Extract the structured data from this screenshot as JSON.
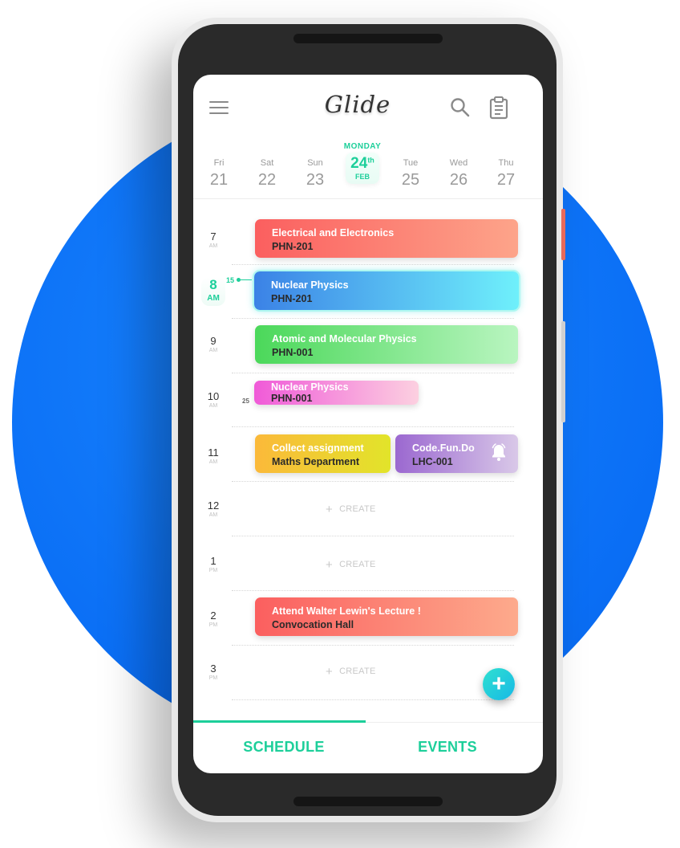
{
  "app": {
    "title": "Glide"
  },
  "colors": {
    "accent": "#1dcf9a",
    "background_circle": "#0a6ef5"
  },
  "dates": [
    {
      "day": "Fri",
      "num": "21"
    },
    {
      "day": "Sat",
      "num": "22"
    },
    {
      "day": "Sun",
      "num": "23"
    },
    {
      "day": "MONDAY",
      "num": "24",
      "suffix": "th",
      "month": "FEB",
      "active": true
    },
    {
      "day": "Tue",
      "num": "25"
    },
    {
      "day": "Wed",
      "num": "26"
    },
    {
      "day": "Thu",
      "num": "27"
    }
  ],
  "hours": [
    {
      "num": "7",
      "suffix": "AM"
    },
    {
      "num": "8",
      "suffix": "AM",
      "current": true
    },
    {
      "num": "9",
      "suffix": "AM"
    },
    {
      "num": "10",
      "suffix": "AM"
    },
    {
      "num": "11",
      "suffix": "AM"
    },
    {
      "num": "12",
      "suffix": "AM"
    },
    {
      "num": "1",
      "suffix": "PM"
    },
    {
      "num": "2",
      "suffix": "PM"
    },
    {
      "num": "3",
      "suffix": "PM"
    }
  ],
  "events": [
    {
      "title": "Electrical and Electronics",
      "subtitle": "PHN-201",
      "gradient": [
        "#fb5f5f",
        "#fda48a"
      ]
    },
    {
      "title": "Nuclear Physics",
      "subtitle": "PHN-201",
      "gradient": [
        "#3b82e6",
        "#6ff0fb"
      ]
    },
    {
      "title": "Atomic and Molecular Physics",
      "subtitle": "PHN-001",
      "gradient": [
        "#4bd85a",
        "#b9f5c0"
      ]
    },
    {
      "title": "Nuclear Physics",
      "subtitle": "PHN-001",
      "gradient": [
        "#f05ad8",
        "#fcd0e0"
      ]
    },
    {
      "title": "Collect assignment",
      "subtitle": "Maths Department",
      "gradient": [
        "#fbb93a",
        "#e2e42a"
      ]
    },
    {
      "title": "Code.Fun.Do",
      "subtitle": "LHC-001",
      "gradient": [
        "#9b68d0",
        "#d9c8e8"
      ],
      "icon": "bell-icon"
    },
    {
      "title": "Attend Walter Lewin's Lecture !",
      "subtitle": "Convocation Hall",
      "gradient": [
        "#fb5f5f",
        "#fdaa8c"
      ]
    }
  ],
  "markers": {
    "current_time": "15",
    "event_start": "25"
  },
  "create_label": "CREATE",
  "tabs": {
    "schedule": "SCHEDULE",
    "events": "EVENTS",
    "active": "schedule"
  }
}
